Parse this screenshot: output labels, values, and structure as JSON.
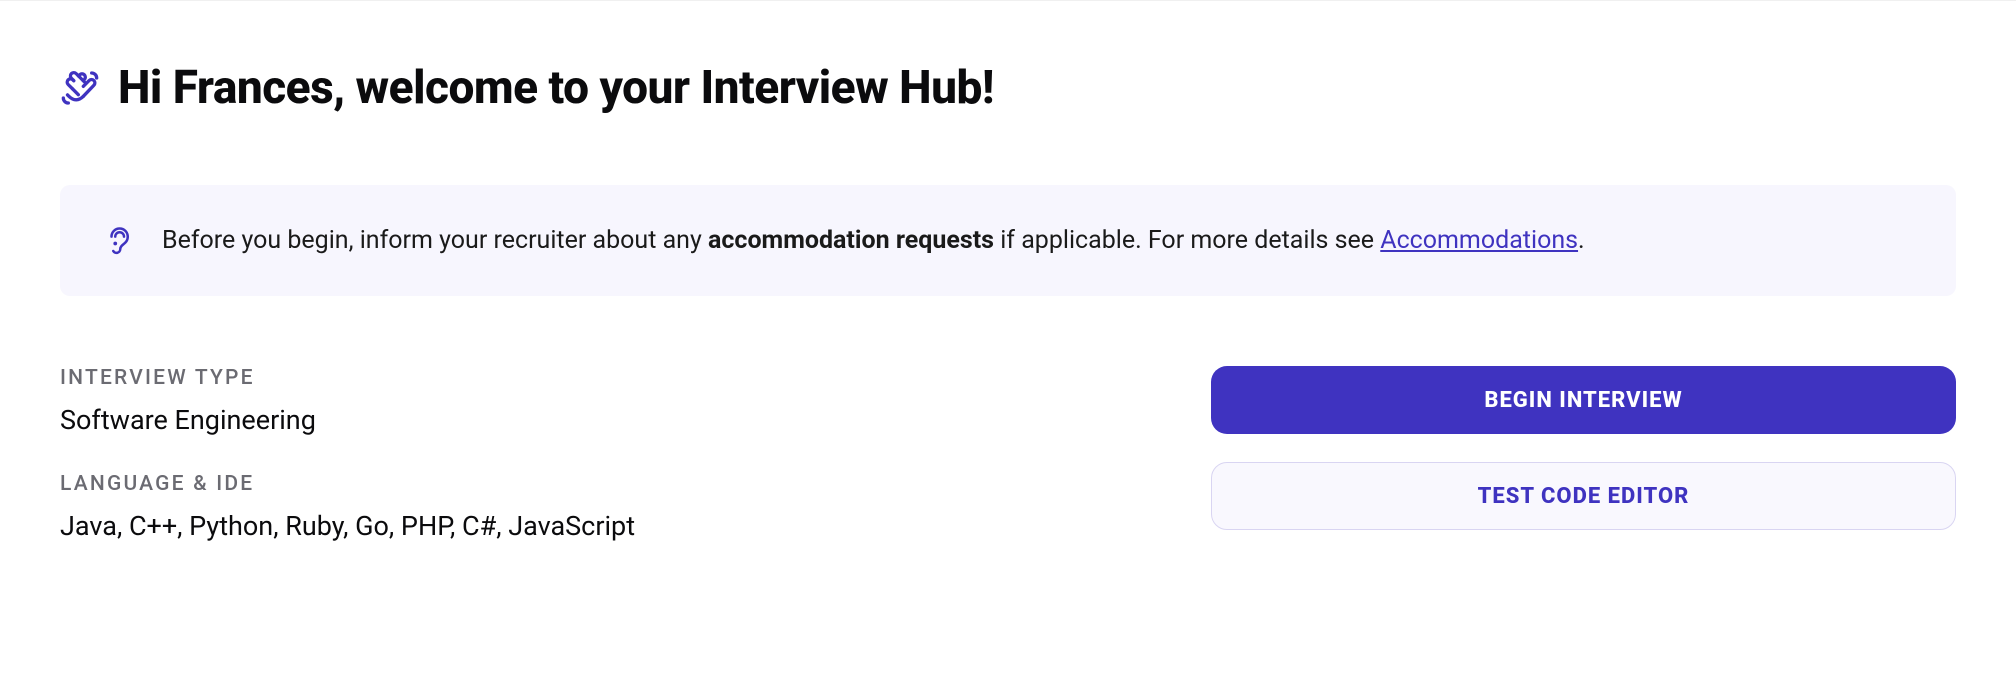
{
  "header": {
    "title": "Hi Frances, welcome to your Interview Hub!"
  },
  "notice": {
    "text_before": "Before you begin, inform your recruiter about any ",
    "text_bold": "accommodation requests",
    "text_mid": " if applicable. For more details see ",
    "link_label": "Accommodations",
    "text_after": "."
  },
  "details": {
    "type_label": "INTERVIEW TYPE",
    "type_value": "Software Engineering",
    "lang_label": "LANGUAGE & IDE",
    "lang_value": "Java, C++, Python, Ruby, Go, PHP, C#, JavaScript"
  },
  "actions": {
    "primary": "BEGIN INTERVIEW",
    "secondary": "TEST CODE EDITOR"
  }
}
